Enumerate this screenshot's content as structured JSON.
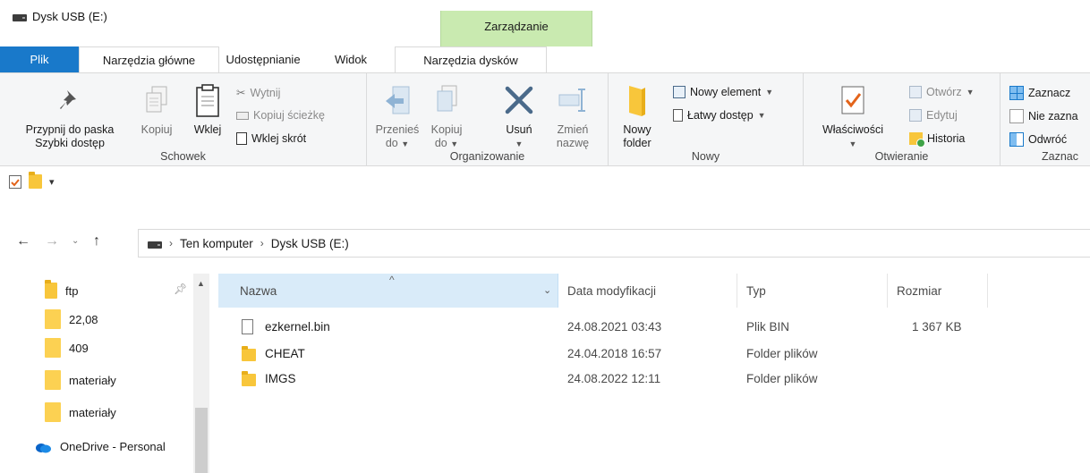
{
  "window": {
    "title": "Dysk USB (E:)",
    "context_group": "Zarządzanie"
  },
  "tabs": [
    "Plik",
    "Narzędzia główne",
    "Udostępnianie",
    "Widok",
    "Narzędzia dysków"
  ],
  "ribbon": {
    "schowek": {
      "label": "Schowek",
      "pin_line1": "Przypnij do paska",
      "pin_line2": "Szybki dostęp",
      "copy": "Kopiuj",
      "paste": "Wklej",
      "cut": "Wytnij",
      "copy_path": "Kopiuj ścieżkę",
      "paste_shortcut": "Wklej skrót"
    },
    "organizowanie": {
      "label": "Organizowanie",
      "move_line1": "Przenieś",
      "move_line2": "do",
      "copyto_line1": "Kopiuj",
      "copyto_line2": "do",
      "delete": "Usuń",
      "rename_line1": "Zmień",
      "rename_line2": "nazwę"
    },
    "nowy": {
      "label": "Nowy",
      "folder_line1": "Nowy",
      "folder_line2": "folder",
      "new_item": "Nowy element",
      "easy_access": "Łatwy dostęp"
    },
    "otwieranie": {
      "label": "Otwieranie",
      "properties": "Właściwości",
      "open": "Otwórz",
      "edit": "Edytuj",
      "history": "Historia"
    },
    "zaznaczanie": {
      "label": "Zaznac",
      "select_all": "Zaznacz",
      "select_none": "Nie zazna",
      "invert": "Odwróć"
    }
  },
  "address": {
    "crumb1": "Ten komputer",
    "crumb2": "Dysk USB (E:)"
  },
  "nav": [
    {
      "label": "ftp"
    },
    {
      "label": "22,08"
    },
    {
      "label": "409"
    },
    {
      "label": "materiały"
    },
    {
      "label": "materiały"
    },
    {
      "label": "OneDrive - Personal"
    }
  ],
  "columns": {
    "name": "Nazwa",
    "date": "Data modyfikacji",
    "type": "Typ",
    "size": "Rozmiar"
  },
  "files": [
    {
      "name": "ezkernel.bin",
      "date": "24.08.2021 03:43",
      "type": "Plik BIN",
      "size": "1 367 KB"
    },
    {
      "name": "CHEAT",
      "date": "24.04.2018 16:57",
      "type": "Folder plików",
      "size": ""
    },
    {
      "name": "IMGS",
      "date": "24.08.2022 12:11",
      "type": "Folder plików",
      "size": ""
    }
  ],
  "colors": {
    "file_tab": "#1979ca",
    "context_tab": "#c9eab0",
    "header_selected": "#d9ebf9",
    "accent": "#0078d7"
  }
}
